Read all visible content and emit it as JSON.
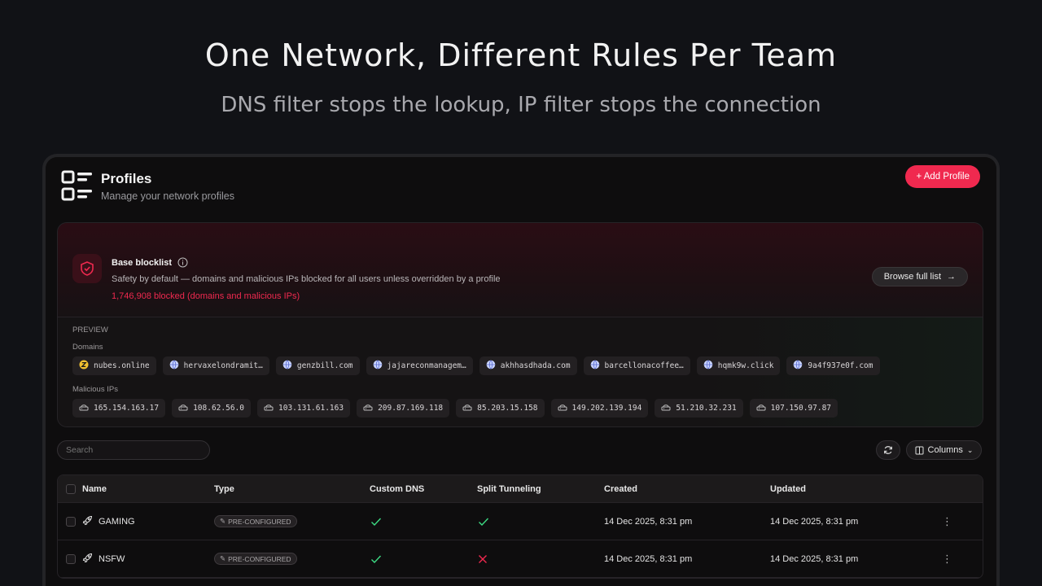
{
  "hero": {
    "title": "One Network, Different Rules Per Team",
    "subtitle": "DNS filter stops the lookup, IP filter stops the connection"
  },
  "header": {
    "title": "Profiles",
    "subtitle": "Manage your network profiles",
    "add_button": "+ Add Profile"
  },
  "blocklist": {
    "name": "Base blocklist",
    "description": "Safety by default — domains and malicious IPs blocked for all users unless overridden by a profile",
    "count": "1,746,908 blocked (domains and malicious IPs)",
    "browse_label": "Browse full list",
    "preview_label": "PREVIEW",
    "domains_label": "Domains",
    "ips_label": "Malicious IPs",
    "domains": [
      "nubes.online",
      "hervaxelondramit…",
      "genzbill.com",
      "jajareconmanagem…",
      "akhhasdhada.com",
      "barcellonacoffee…",
      "hqmk9w.click",
      "9a4f937e0f.com"
    ],
    "ips": [
      "165.154.163.17",
      "108.62.56.0",
      "103.131.61.163",
      "209.87.169.118",
      "85.203.15.158",
      "149.202.139.194",
      "51.210.32.231",
      "107.150.97.87"
    ]
  },
  "toolbar": {
    "search_placeholder": "Search",
    "columns_label": "Columns"
  },
  "table": {
    "headers": [
      "Name",
      "Type",
      "Custom DNS",
      "Split Tunneling",
      "Created",
      "Updated"
    ],
    "rows": [
      {
        "name": "GAMING",
        "type": "PRE-CONFIGURED",
        "custom_dns": true,
        "split_tunneling": true,
        "created": "14 Dec 2025, 8:31 pm",
        "updated": "14 Dec 2025, 8:31 pm"
      },
      {
        "name": "NSFW",
        "type": "PRE-CONFIGURED",
        "custom_dns": true,
        "split_tunneling": false,
        "created": "14 Dec 2025, 8:31 pm",
        "updated": "14 Dec 2025, 8:31 pm"
      }
    ]
  },
  "colors": {
    "accent": "#f0294f",
    "check": "#3ddc84",
    "cross": "#f0294f"
  }
}
